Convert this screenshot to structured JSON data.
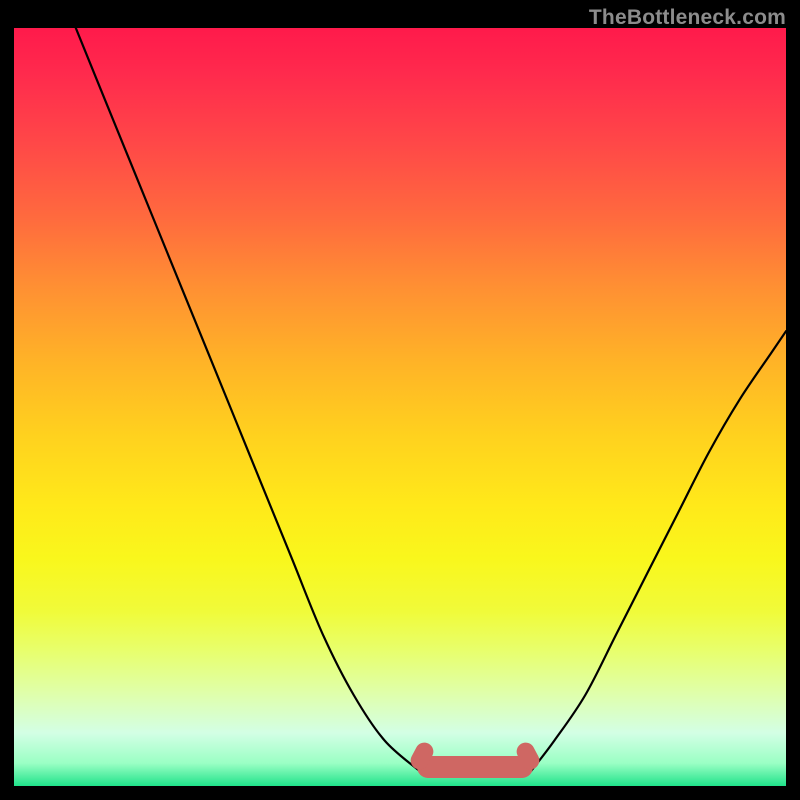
{
  "source_label": "TheBottleneck.com",
  "chart_data": {
    "type": "line",
    "title": "",
    "xlabel": "",
    "ylabel": "",
    "xlim": [
      0,
      100
    ],
    "ylim": [
      0,
      100
    ],
    "grid": false,
    "legend": false,
    "series": [
      {
        "name": "left-curve",
        "x": [
          8,
          12,
          16,
          20,
          24,
          28,
          32,
          36,
          40,
          44,
          48,
          52.5
        ],
        "y": [
          100,
          90,
          80,
          70,
          60,
          50,
          40,
          30,
          20,
          12,
          6,
          2
        ]
      },
      {
        "name": "right-curve",
        "x": [
          67,
          70,
          74,
          78,
          82,
          86,
          90,
          94,
          98,
          100
        ],
        "y": [
          2,
          6,
          12,
          20,
          28,
          36,
          44,
          51,
          57,
          60
        ]
      }
    ],
    "hump": {
      "x_start": 52.5,
      "x_end": 67,
      "amplitude": 3,
      "color": "#cf6763"
    },
    "background_gradient": {
      "top": "#ff1a4b",
      "bottom": "#20e28a"
    }
  }
}
